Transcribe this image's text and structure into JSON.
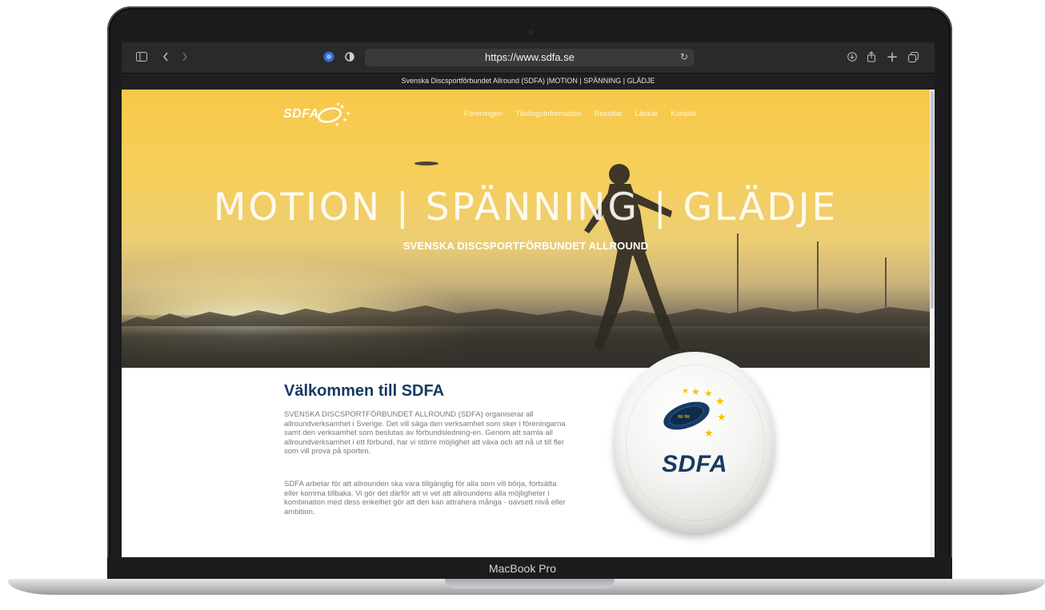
{
  "device": {
    "label": "MacBook Pro"
  },
  "browser": {
    "url": "https://www.sdfa.se",
    "tab_title": "Svenska Discsportförbundet Allround (SDFA) |MOTION | SPÄNNING | GLÄDJE",
    "icons": [
      "sidebar-icon",
      "back-icon",
      "forward-icon",
      "privacy-shield-icon",
      "adblock-icon",
      "reload-icon",
      "download-icon",
      "share-icon",
      "new-tab-icon",
      "tabs-overview-icon"
    ]
  },
  "site": {
    "logo_text": "SDFA",
    "nav": [
      "Föreningen",
      "Tävlingsinformation",
      "Resultat",
      "Länkar",
      "Kontakt"
    ],
    "hero": {
      "title": "MOTION | SPÄNNING | GLÄDJE",
      "subtitle": "SVENSKA DISCSPORTFÖRBUNDET ALLROUND"
    },
    "welcome": {
      "title": "Välkommen till SDFA",
      "paragraph1": "SVENSKA DISCSPORTFÖRBUNDET ALLROUND (SDFA) organiserar all allroundverksamhet i Sverige. Det vill säga den verksamhet som sker i föreningarna samt den verksamhet som beslutas av förbundsledning-en. Genom att samla all allroundverksamhet i ett förbund, har vi större möjlighet att växa och att nå ut till fler som vill prova på sporten.",
      "paragraph2": "SDFA arbetar för att allrounden ska vara tillgänglig för alla som vill börja, fortsätta eller komma tillbaka. Vi gör det därför att vi vet att allroundens alla möjligheter i kombination med dess enkelhet gör att den kan attrahera många - oavsett nivå eller ambition."
    },
    "frisbee_text": "SDFA"
  },
  "colors": {
    "brand_navy": "#173a63",
    "brand_yellow": "#f6c94a",
    "star_yellow": "#f5c400"
  }
}
